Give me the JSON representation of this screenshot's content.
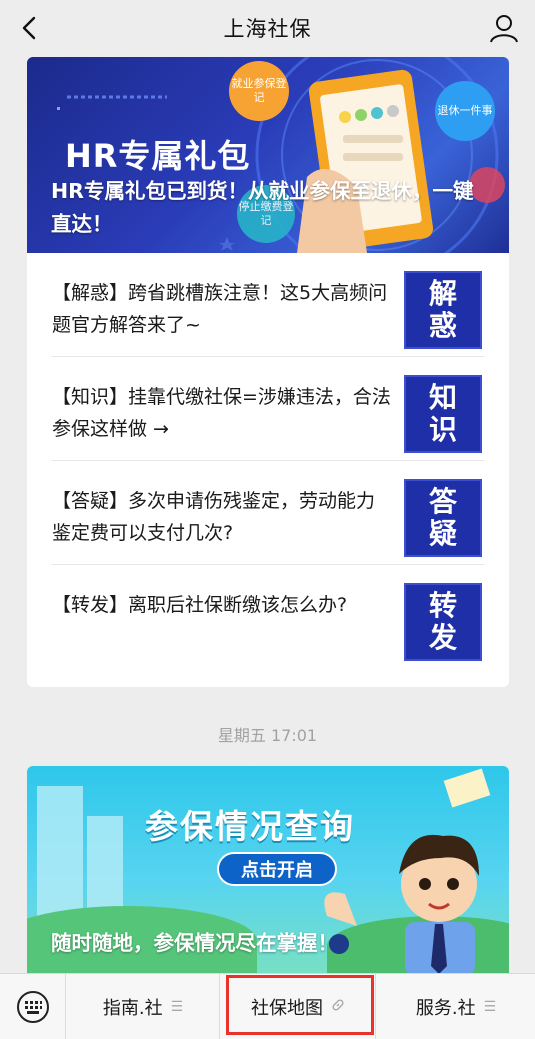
{
  "header": {
    "title": "上海社保",
    "back_icon": "chevron-left-icon",
    "profile_icon": "user-icon"
  },
  "article_card": {
    "banner": {
      "heading": "HR专属礼包",
      "caption": "HR专属礼包已到货！从就业参保至退休，一键直达！",
      "bubbles": [
        "就业参保登记",
        "退休一件事",
        "停止缴费登记"
      ]
    },
    "items": [
      {
        "text": "【解惑】跨省跳槽族注意！这5大高频问题官方解答来了~",
        "thumb": "解惑"
      },
      {
        "text": "【知识】挂靠代缴社保=涉嫌违法，合法参保这样做 →",
        "thumb": "知识"
      },
      {
        "text": "【答疑】多次申请伤残鉴定，劳动能力鉴定费可以支付几次?",
        "thumb": "答疑"
      },
      {
        "text": "【转发】离职后社保断缴该怎么办?",
        "thumb": "转发"
      }
    ]
  },
  "timestamp": "星期五 17:01",
  "promo_card": {
    "heading": "参保情况查询",
    "button": "点击开启",
    "caption": "随时随地，参保情况尽在掌握！"
  },
  "bottom_menu": {
    "keyboard_icon": "keyboard-icon",
    "items": [
      {
        "label": "指南.社",
        "icon": "menu-lines-icon"
      },
      {
        "label": "社保地图",
        "icon": "link-icon"
      },
      {
        "label": "服务.社",
        "icon": "menu-lines-icon"
      }
    ],
    "highlight_color": "#e8322b"
  },
  "colors": {
    "banner_blue": "#2a3cb8",
    "thumb_blue": "#1f2fa8",
    "promo_cyan": "#2ec7ea"
  }
}
